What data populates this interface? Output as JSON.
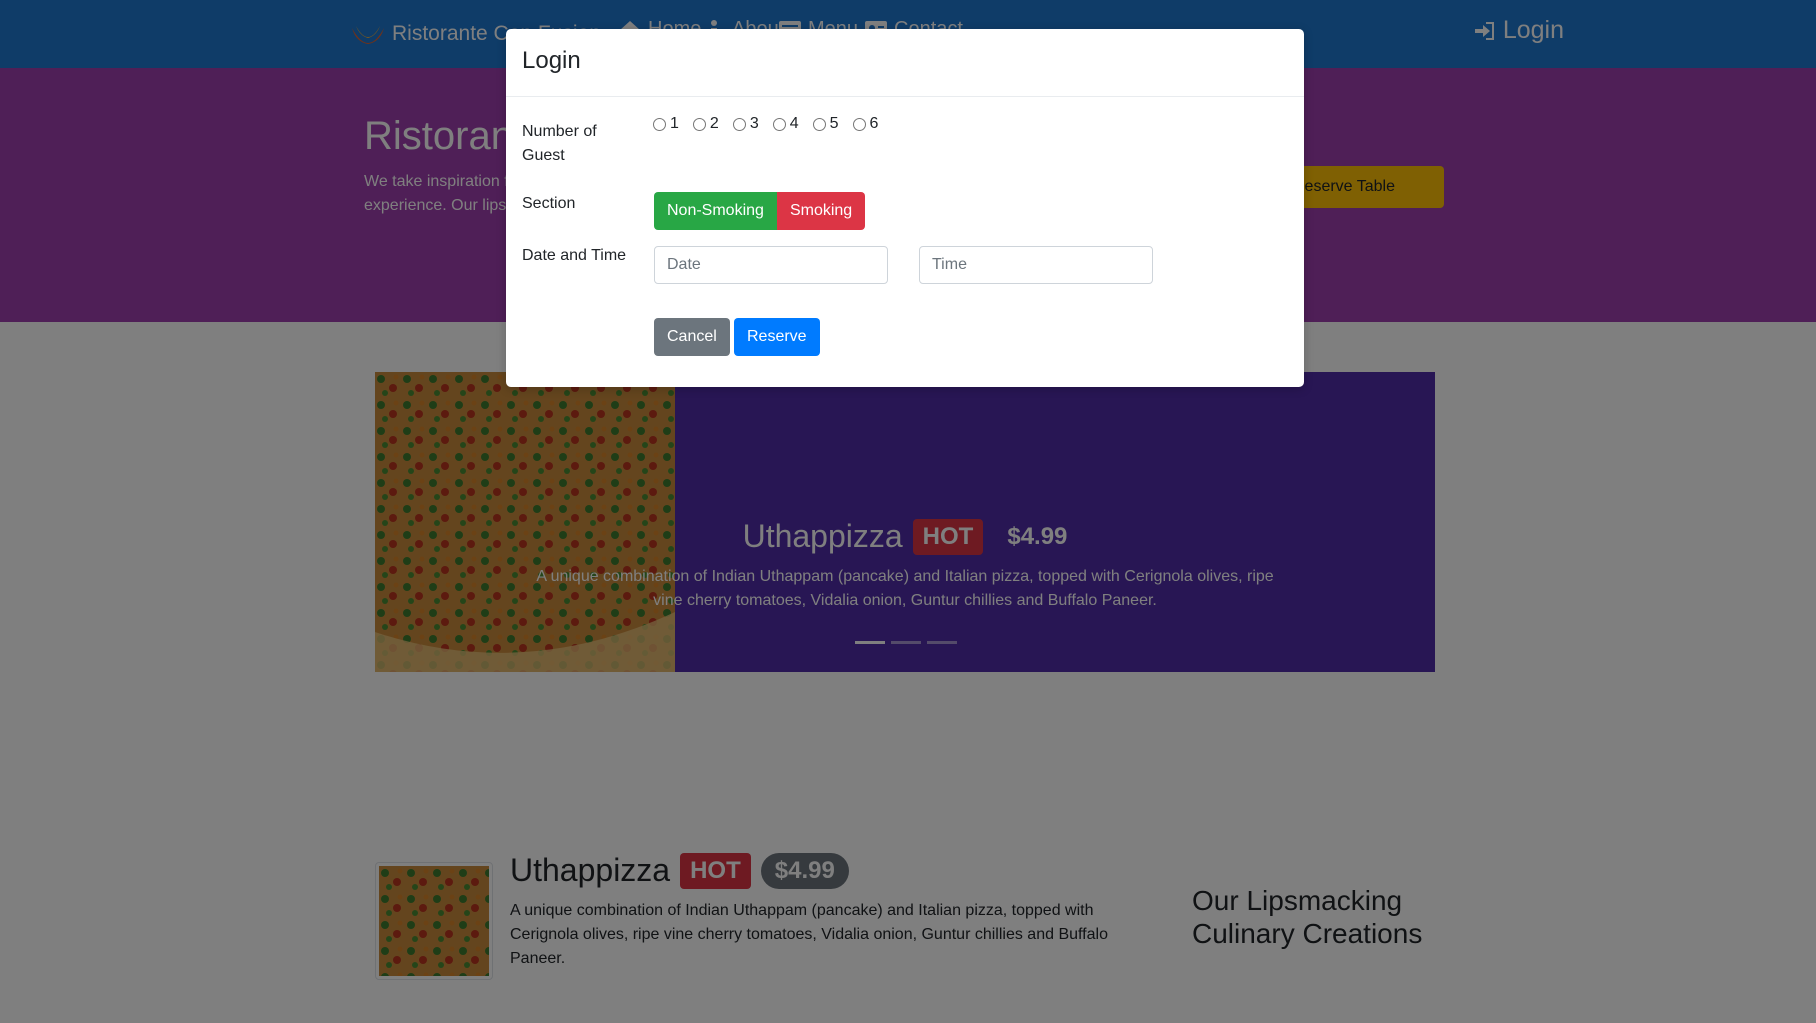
{
  "navbar": {
    "brand": "Ristorante Con Fusion",
    "items": [
      {
        "label": "Home",
        "icon": "home-icon"
      },
      {
        "label": "About",
        "icon": "info-icon"
      },
      {
        "label": "Menu",
        "icon": "list-icon"
      },
      {
        "label": "Contact",
        "icon": "address-card-icon"
      }
    ],
    "login": "Login"
  },
  "jumbotron": {
    "title": "Ristorante con Fusion",
    "text": "We take inspiration from the World's best cuisines, and create a unique fusion experience. Our lipsmacking creations will tickle your culinary senses!",
    "reserve_button": "Reserve Table"
  },
  "carousel": {
    "title": "Uthappizza",
    "badge": "HOT",
    "price": "$4.99",
    "description": "A unique combination of Indian Uthappam (pancake) and Italian pizza, topped with Cerignola olives, ripe vine cherry tomatoes, Vidalia onion, Guntur chillies and Buffalo Paneer."
  },
  "media": {
    "title": "Uthappizza",
    "badge": "HOT",
    "price": "$4.99",
    "description": "A unique combination of Indian Uthappam (pancake) and Italian pizza, topped with Cerignola olives, ripe vine cherry tomatoes, Vidalia onion, Guntur chillies and Buffalo Paneer."
  },
  "creations_heading": "Our Lipsmacking Culinary Creations",
  "modal": {
    "title": "Login",
    "guests_label": "Number of Guest",
    "guest_options": [
      "1",
      "2",
      "3",
      "4",
      "5",
      "6"
    ],
    "section_label": "Section",
    "section_non_smoking": "Non-Smoking",
    "section_smoking": "Smoking",
    "datetime_label": "Date and Time",
    "date_placeholder": "Date",
    "time_placeholder": "Time",
    "cancel": "Cancel",
    "reserve": "Reserve"
  },
  "colors": {
    "navbar": "#1f78d1",
    "jumbotron": "#9f3fae",
    "carousel": "#512da8",
    "reserve_table": "#ffc107",
    "success": "#28a745",
    "danger": "#dc3545",
    "primary": "#007bff",
    "secondary": "#6c757d"
  }
}
